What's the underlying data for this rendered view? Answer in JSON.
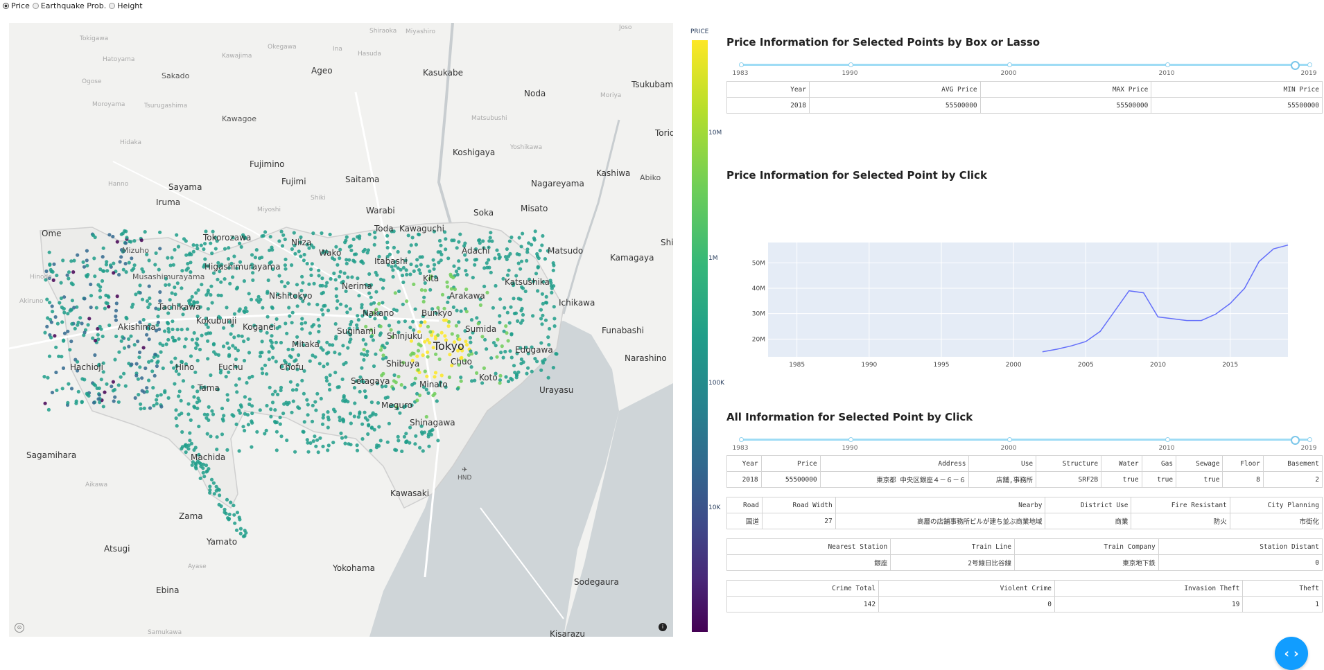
{
  "radio_group": {
    "options": [
      {
        "label": "Price",
        "selected": true
      },
      {
        "label": "Earthquake Prob.",
        "selected": false
      },
      {
        "label": "Height",
        "selected": false
      }
    ]
  },
  "map": {
    "labels": {
      "tokigawa": "Tokigawa",
      "hatoyama": "Hatoyama",
      "ogose": "Ogose",
      "moroyama": "Moroyama",
      "tsurugashima": "Tsurugashima",
      "sakado": "Sakado",
      "kawagoe": "Kawagoe",
      "kawajima": "Kawajima",
      "okegawa": "Okegawa",
      "ina": "Ina",
      "hasuda": "Hasuda",
      "shiraoka": "Shiraoka",
      "miyashiro": "Miyashiro",
      "ageo": "Ageo",
      "kasukabe": "Kasukabe",
      "noda": "Noda",
      "moriya": "Moriya",
      "joso": "Joso",
      "tsukubamirai": "Tsukubami",
      "toride": "Torid",
      "matsubushi": "Matsubushi",
      "yoshikawa": "Yoshikawa",
      "koshigaya": "Koshigaya",
      "kashiwa": "Kashiwa",
      "abiko": "Abiko",
      "nagareyama": "Nagareyama",
      "fujimino": "Fujimino",
      "fujimi": "Fujimi",
      "saitama": "Saitama",
      "hidaka": "Hidaka",
      "hanno": "Hanno",
      "sayama": "Sayama",
      "iruma": "Iruma",
      "miyoshi": "Miyoshi",
      "shiki": "Shiki",
      "warabi": "Warabi",
      "soka": "Soka",
      "misato": "Misato",
      "ome": "Ome",
      "tokorozawa": "Tokorozawa",
      "niiza": "Niiza",
      "toda": "Toda",
      "kawaguchi": "Kawaguchi",
      "matsudo": "Matsudo",
      "kamagaya": "Kamagaya",
      "shiroi": "Shi",
      "mizuho": "Mizuho",
      "hinode": "Hinode",
      "higashimurayama": "Higashimurayama",
      "musashimurayama": "Musashimurayama",
      "wako": "Wako",
      "itabashi": "Itabashi",
      "adachi": "Adachi",
      "katsushika": "Katsushika",
      "nishitokyo": "Nishitokyo",
      "nerima": "Nerima",
      "kita": "Kita",
      "arakawa": "Arakawa",
      "ichikawa": "Ichikawa",
      "akiruno": "Akiruno",
      "tachikawa": "Tachikawa",
      "kokubunji": "Kokubunji",
      "koganei": "Koganei",
      "nakano": "Nakano",
      "bunkyo": "Bunkyo",
      "sumida": "Sumida",
      "akishima": "Akishima",
      "mitaka": "Mitaka",
      "suginami": "Suginami",
      "shinjuku": "Shinjuku",
      "tokyo": "Tokyo",
      "funabashi": "Funabashi",
      "edogawa": "Edogawa",
      "hachioji": "Hachioji",
      "hino": "Hino",
      "fuchu": "Fuchu",
      "chofu": "Chofu",
      "shibuya": "Shibuya",
      "chuo": "Chuo",
      "koto": "Koto",
      "narashino": "Narashino",
      "tama": "Tama",
      "setagaya": "Setagaya",
      "minato": "Minato",
      "urayasu": "Urayasu",
      "meguro": "Meguro",
      "shinagawa": "Shinagawa",
      "sagamihara": "Sagamihara",
      "aikawa": "Aikawa",
      "machida": "Machida",
      "hnd": "HND",
      "kawasaki": "Kawasaki",
      "zama": "Zama",
      "yamato": "Yamato",
      "atsugi": "Atsugi",
      "ayase": "Ayase",
      "yokohama": "Yokohama",
      "sodegaura": "Sodegaura",
      "ebina": "Ebina",
      "samukawa": "Samukawa",
      "kisarazu": "Kisarazu"
    }
  },
  "colorbar": {
    "title": "PRICE",
    "ticks": [
      "10M",
      "1M",
      "100K",
      "10K"
    ],
    "colors": [
      "#fde725",
      "#6ece58",
      "#1f9e89",
      "#31688e",
      "#440154"
    ]
  },
  "section1": {
    "title": "Price Information for Selected Points by Box or Lasso",
    "slider": {
      "labels": [
        "1983",
        "1990",
        "2000",
        "2010",
        "2019"
      ],
      "value": "2018"
    },
    "table": {
      "headers": [
        "Year",
        "AVG Price",
        "MAX Price",
        "MIN Price"
      ],
      "row": [
        "2018",
        "55500000",
        "55500000",
        "55500000"
      ]
    }
  },
  "section2": {
    "title": "Price Information for Selected Point by Click",
    "chart_data": {
      "type": "line",
      "title": "",
      "xlabel": "",
      "ylabel": "",
      "x": [
        2002,
        2003,
        2004,
        2005,
        2006,
        2007,
        2008,
        2009,
        2010,
        2011,
        2012,
        2013,
        2014,
        2015,
        2016,
        2017,
        2018,
        2019
      ],
      "y": [
        15000000,
        16000000,
        17300000,
        19000000,
        23000000,
        31000000,
        39000000,
        38200000,
        28700000,
        28000000,
        27300000,
        27300000,
        29800000,
        34000000,
        40000000,
        50500000,
        55500000,
        57000000
      ],
      "xlim": [
        1983,
        2019
      ],
      "ylim": [
        13000000,
        58000000
      ],
      "xticks": [
        "1985",
        "1990",
        "1995",
        "2000",
        "2005",
        "2010",
        "2015"
      ],
      "yticks": [
        "20M",
        "30M",
        "40M",
        "50M"
      ],
      "line_color": "#636efa",
      "plot_bg": "#e5ecf6"
    }
  },
  "section3": {
    "title": "All Information for Selected Point by Click",
    "slider": {
      "labels": [
        "1983",
        "1990",
        "2000",
        "2010",
        "2019"
      ],
      "value": "2018"
    },
    "table1": {
      "headers": [
        "Year",
        "Price",
        "Address",
        "Use",
        "Structure",
        "Water",
        "Gas",
        "Sewage",
        "Floor",
        "Basement"
      ],
      "row": [
        "2018",
        "55500000",
        "東京都 中央区銀座４－６－６",
        "店舗,事務所",
        "SRF2B",
        "true",
        "true",
        "true",
        "8",
        "2"
      ]
    },
    "table2": {
      "headers": [
        "Road",
        "Road Width",
        "Nearby",
        "District Use",
        "Fire Resistant",
        "City Planning"
      ],
      "row": [
        "国道",
        "27",
        "高層の店舗事務所ビルが建ち並ぶ商業地域",
        "商業",
        "防火",
        "市街化"
      ]
    },
    "table3": {
      "headers": [
        "Nearest Station",
        "Train Line",
        "Train Company",
        "Station Distant"
      ],
      "row": [
        "銀座",
        "2号線日比谷線",
        "東京地下鉄",
        "0"
      ]
    },
    "table4": {
      "headers": [
        "Crime Total",
        "Violent Crime",
        "Invasion Theft",
        "Theft"
      ],
      "row": [
        "142",
        "0",
        "19",
        "1"
      ]
    }
  },
  "fab": {
    "icon": "code-icon",
    "glyph": "‹ ›"
  }
}
